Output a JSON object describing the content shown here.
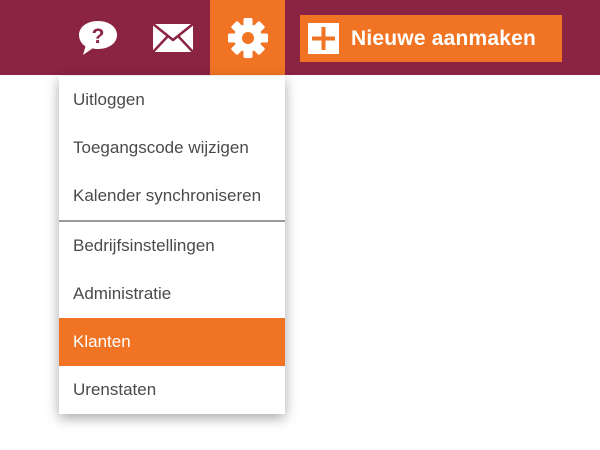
{
  "header": {
    "help_icon": "help-question-icon",
    "mail_icon": "mail-envelope-icon",
    "settings_icon": "gear-icon",
    "new_button": {
      "icon": "plus-icon",
      "label": "Nieuwe aanmaken"
    }
  },
  "settings_menu": {
    "group1": [
      {
        "label": "Uitloggen"
      },
      {
        "label": "Toegangscode wijzigen"
      },
      {
        "label": "Kalender synchroniseren"
      }
    ],
    "group2": [
      {
        "label": "Bedrijfsinstellingen"
      },
      {
        "label": "Administratie"
      },
      {
        "label": "Klanten",
        "active": true
      },
      {
        "label": "Urenstaten"
      }
    ]
  },
  "colors": {
    "topbar": "#8b2342",
    "accent": "#f07423",
    "menu_text": "#4a4a4a",
    "white": "#ffffff"
  }
}
